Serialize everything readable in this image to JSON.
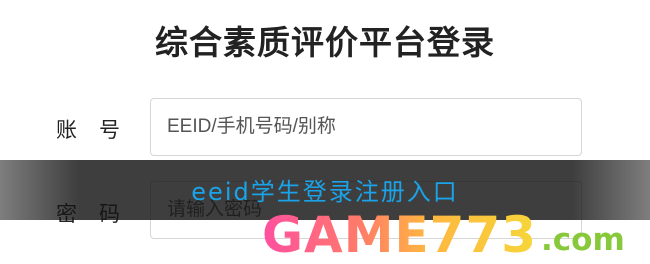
{
  "page": {
    "title": "综合素质评价平台登录"
  },
  "form": {
    "account_label": "账号",
    "account_placeholder": "EEID/手机号码/别称",
    "password_label": "密码",
    "password_placeholder": "请输入密码"
  },
  "overlay": {
    "caption": "eeid学生登录注册入口",
    "watermark_main": "GAME773",
    "watermark_tail": ".com"
  },
  "colors": {
    "caption": "#1aa3e8",
    "watermark_start": "#ff4fa0",
    "watermark_end": "#f5d63a",
    "watermark_tail": "#88c93b"
  }
}
